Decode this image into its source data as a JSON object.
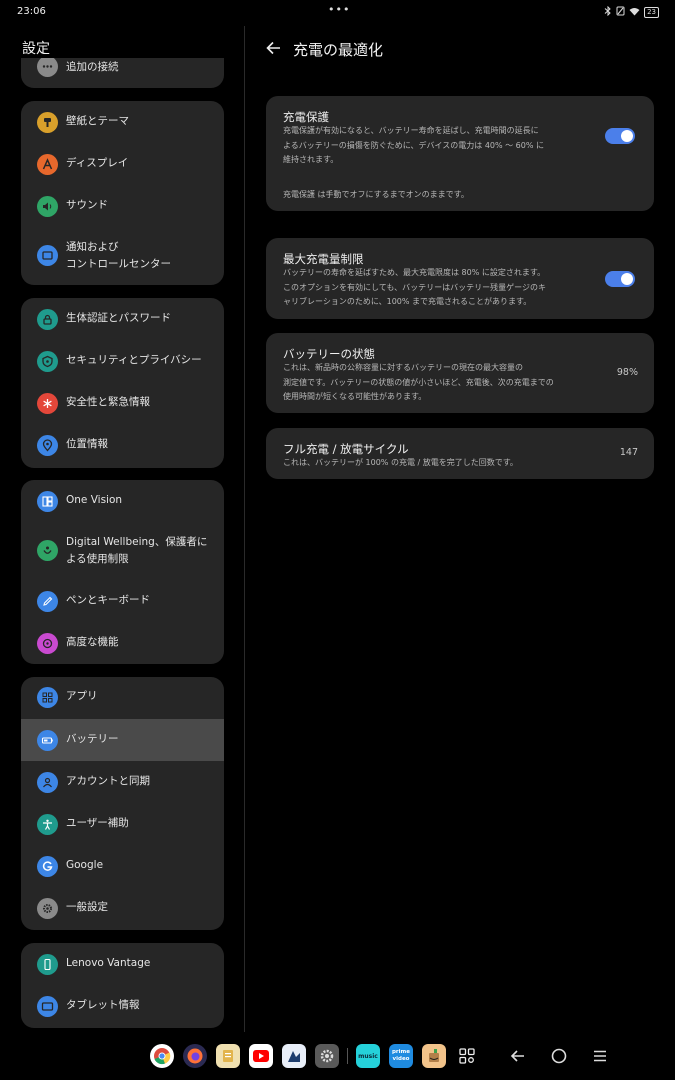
{
  "status_bar": {
    "time": "23:06",
    "dots": "•••",
    "battery": "23"
  },
  "left": {
    "title": "設定",
    "partial_item": "追加の接続",
    "groups": [
      {
        "items": [
          {
            "label": "壁紙とテーマ",
            "icon": "palette-icon",
            "color": "#d9a02b"
          },
          {
            "label": "ディスプレイ",
            "icon": "display-icon",
            "color": "#e7682c"
          },
          {
            "label": "サウンド",
            "icon": "sound-icon",
            "color": "#2fa566"
          },
          {
            "label": "通知および\nコントロールセンター",
            "icon": "notification-icon",
            "color": "#3d86e6"
          }
        ]
      },
      {
        "items": [
          {
            "label": "生体認証とパスワード",
            "icon": "lock-icon",
            "color": "#1f9b8d"
          },
          {
            "label": "セキュリティとプライバシー",
            "icon": "shield-icon",
            "color": "#1f9b8d"
          },
          {
            "label": "安全性と緊急情報",
            "icon": "asterisk-icon",
            "color": "#e4473a"
          },
          {
            "label": "位置情報",
            "icon": "location-icon",
            "color": "#3d86e6"
          }
        ]
      },
      {
        "items": [
          {
            "label": "One Vision",
            "icon": "one-vision-icon",
            "color": "#3d86e6"
          },
          {
            "label": "Digital Wellbeing、保護者に\nよる使用制限",
            "icon": "wellbeing-icon",
            "color": "#2fa566"
          },
          {
            "label": "ペンとキーボード",
            "icon": "pen-icon",
            "color": "#3d86e6"
          },
          {
            "label": "高度な機能",
            "icon": "advanced-icon",
            "color": "#c94ad0"
          }
        ]
      },
      {
        "items": [
          {
            "label": "アプリ",
            "icon": "apps-icon",
            "color": "#3d86e6"
          },
          {
            "label": "バッテリー",
            "icon": "battery-icon",
            "color": "#3d86e6"
          },
          {
            "label": "アカウントと同期",
            "icon": "account-icon",
            "color": "#3d86e6"
          },
          {
            "label": "ユーザー補助",
            "icon": "accessibility-icon",
            "color": "#1f9b8d"
          },
          {
            "label": "Google",
            "icon": "google-icon",
            "color": "#3d86e6"
          },
          {
            "label": "一般設定",
            "icon": "gear-icon",
            "color": "#8a8a8a"
          }
        ]
      },
      {
        "items": [
          {
            "label": "Lenovo Vantage",
            "icon": "lenovo-vantage-icon",
            "color": "#1f9b8d"
          },
          {
            "label": "タブレット情報",
            "icon": "tablet-icon",
            "color": "#3d86e6"
          }
        ]
      }
    ],
    "selected": "バッテリー"
  },
  "right": {
    "title": "充電の最適化",
    "cards": [
      {
        "title": "充電保護",
        "desc": "充電保護が有効になると、バッテリー寿命を延ばし、充電時間の延長に\nよるバッテリーの損傷を防ぐために、デバイスの電力は 40% 〜 60% に\n維持されます。",
        "note": "充電保護 は手動でオフにするまでオンのままです。",
        "toggle_on": true
      },
      {
        "title": "最大充電量制限",
        "desc": "バッテリーの寿命を延ばすため、最大充電限度は 80% に設定されます。\nこのオプションを有効にしても、バッテリーはバッテリー残量ゲージのキ\nャリブレーションのために、100% まで充電されることがあります。",
        "toggle_on": true
      },
      {
        "title": "バッテリーの状態",
        "desc": "これは、新品時の公称容量に対するバッテリーの現在の最大容量の\n測定値です。バッテリーの状態の値が小さいほど、充電後、次の充電までの\n使用時間が短くなる可能性があります。",
        "value": "98%"
      },
      {
        "title": "フル充電 / 放電サイクル",
        "desc": "これは、バッテリーが 100% の充電 / 放電を完了した回数です。",
        "value": "147"
      }
    ]
  },
  "dock": {
    "apps": [
      {
        "name": "chrome-icon",
        "color": "#ffffff"
      },
      {
        "name": "firefox-icon",
        "color": "#2b2a52"
      },
      {
        "name": "files-icon",
        "color": "#f0e0b0"
      },
      {
        "name": "youtube-icon",
        "color": "#ffffff"
      },
      {
        "name": "edit-app-icon",
        "color": "#e8eef8"
      },
      {
        "name": "settings-app-icon",
        "color": "#5a5a5a"
      },
      {
        "name": "amazon-music-icon",
        "color": "#25d1da",
        "text": "music"
      },
      {
        "name": "prime-video-icon",
        "color": "#1f8be0",
        "text": "prime video"
      },
      {
        "name": "amazon-shopping-icon",
        "color": "#f2c38a"
      },
      {
        "name": "app-drawer-icon",
        "color": "#000000"
      }
    ]
  }
}
